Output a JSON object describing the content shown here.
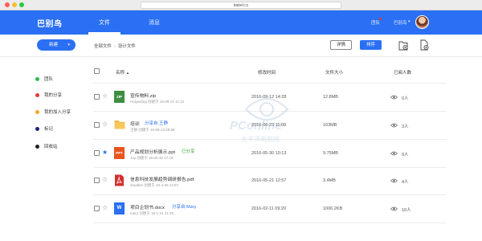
{
  "browser": {
    "url": "babel.cc"
  },
  "header": {
    "logo": "巴别鸟",
    "nav": [
      {
        "label": "文件",
        "active": true
      },
      {
        "label": "消息",
        "active": false
      }
    ],
    "team_link": "团队",
    "user_name": "巴别鸟",
    "user_caret": "▾",
    "accent": "#2a6ff4"
  },
  "toolbar": {
    "new_label": "新建",
    "new_caret": "▾",
    "breadcrumb": [
      "全部文件",
      "设计文件"
    ],
    "breadcrumb_sep": "›",
    "details_label": "详情",
    "sort_label": "排序"
  },
  "sidebar": {
    "items": [
      {
        "label": "团队",
        "color": "#2db84c"
      },
      {
        "label": "我的分享",
        "color": "#e53935"
      },
      {
        "label": "我的加入分享",
        "color": "#f5a623"
      },
      {
        "label": "标记",
        "color": "#1a237e"
      },
      {
        "label": "回收站",
        "color": "#222222"
      }
    ]
  },
  "table": {
    "headers": {
      "name": "名称",
      "sort_arrow": "▲",
      "modified": "修改时间",
      "size": "文件大小",
      "viewers": "已阅人数"
    },
    "rows": [
      {
        "name": "宣传物料.zip",
        "meta": "Holywding 创建于 18-09-12 11:14",
        "share": "",
        "share_style": "",
        "modified": "2016-09-12 14:28",
        "size": "12.8MB",
        "viewers": "0人",
        "starred": false,
        "icon_type": "zip",
        "icon_label": "ZIP",
        "icon_color": "#3e8e41"
      },
      {
        "name": "培训",
        "meta": "王静 创建于 16-06-13 08:58",
        "share": "分享自 王静",
        "share_style": "blue",
        "modified": "2016-06-23 11:08",
        "size": "103MB",
        "viewers": "3人",
        "starred": false,
        "icon_type": "folder",
        "icon_label": "",
        "icon_color": "#f5b942"
      },
      {
        "name": "产品规划分析展示.ppt",
        "meta": "Joy 创建于 16-05-30 17:18",
        "share": "已分享",
        "share_style": "green",
        "modified": "2016-05-30 10:13",
        "size": "9.75MB",
        "viewers": "9人",
        "starred": true,
        "icon_type": "ppt",
        "icon_label": "PPT",
        "icon_color": "#e8541e"
      },
      {
        "name": "信息科技发展趋势调研报告.pdf",
        "meta": "doudlee 创建于 16-4-30 14:57",
        "share": "",
        "share_style": "",
        "modified": "2016-05-21 12:57",
        "size": "3.4MB",
        "viewers": "4人",
        "starred": false,
        "icon_type": "pdf",
        "icon_label": "PDF",
        "icon_color": "#d32f2f"
      },
      {
        "name": "项目企划书.docx",
        "meta": "mary 创建于 16-1-31 21:29",
        "share": "分享自 Mary",
        "share_style": "blue",
        "modified": "2016-02-11 09:20",
        "size": "1006.2KB",
        "viewers": "10人",
        "starred": false,
        "icon_type": "doc",
        "icon_label": "W",
        "icon_color": "#2a6ff4"
      }
    ]
  },
  "watermark": {
    "brand": "PConline",
    "sub": "太平洋电脑网"
  }
}
